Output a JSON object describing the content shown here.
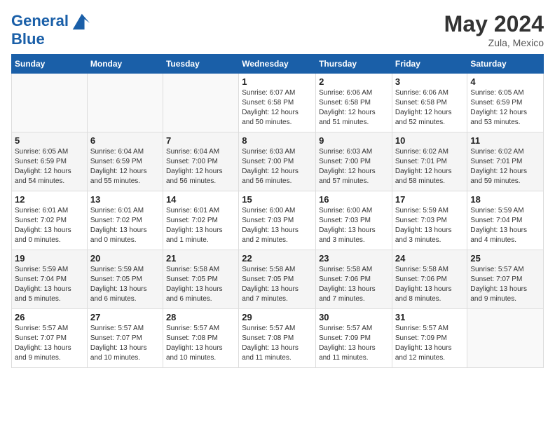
{
  "header": {
    "logo_line1": "General",
    "logo_line2": "Blue",
    "month": "May 2024",
    "location": "Zula, Mexico"
  },
  "weekdays": [
    "Sunday",
    "Monday",
    "Tuesday",
    "Wednesday",
    "Thursday",
    "Friday",
    "Saturday"
  ],
  "weeks": [
    [
      {
        "day": "",
        "info": ""
      },
      {
        "day": "",
        "info": ""
      },
      {
        "day": "",
        "info": ""
      },
      {
        "day": "1",
        "info": "Sunrise: 6:07 AM\nSunset: 6:58 PM\nDaylight: 12 hours\nand 50 minutes."
      },
      {
        "day": "2",
        "info": "Sunrise: 6:06 AM\nSunset: 6:58 PM\nDaylight: 12 hours\nand 51 minutes."
      },
      {
        "day": "3",
        "info": "Sunrise: 6:06 AM\nSunset: 6:58 PM\nDaylight: 12 hours\nand 52 minutes."
      },
      {
        "day": "4",
        "info": "Sunrise: 6:05 AM\nSunset: 6:59 PM\nDaylight: 12 hours\nand 53 minutes."
      }
    ],
    [
      {
        "day": "5",
        "info": "Sunrise: 6:05 AM\nSunset: 6:59 PM\nDaylight: 12 hours\nand 54 minutes."
      },
      {
        "day": "6",
        "info": "Sunrise: 6:04 AM\nSunset: 6:59 PM\nDaylight: 12 hours\nand 55 minutes."
      },
      {
        "day": "7",
        "info": "Sunrise: 6:04 AM\nSunset: 7:00 PM\nDaylight: 12 hours\nand 56 minutes."
      },
      {
        "day": "8",
        "info": "Sunrise: 6:03 AM\nSunset: 7:00 PM\nDaylight: 12 hours\nand 56 minutes."
      },
      {
        "day": "9",
        "info": "Sunrise: 6:03 AM\nSunset: 7:00 PM\nDaylight: 12 hours\nand 57 minutes."
      },
      {
        "day": "10",
        "info": "Sunrise: 6:02 AM\nSunset: 7:01 PM\nDaylight: 12 hours\nand 58 minutes."
      },
      {
        "day": "11",
        "info": "Sunrise: 6:02 AM\nSunset: 7:01 PM\nDaylight: 12 hours\nand 59 minutes."
      }
    ],
    [
      {
        "day": "12",
        "info": "Sunrise: 6:01 AM\nSunset: 7:02 PM\nDaylight: 13 hours\nand 0 minutes."
      },
      {
        "day": "13",
        "info": "Sunrise: 6:01 AM\nSunset: 7:02 PM\nDaylight: 13 hours\nand 0 minutes."
      },
      {
        "day": "14",
        "info": "Sunrise: 6:01 AM\nSunset: 7:02 PM\nDaylight: 13 hours\nand 1 minute."
      },
      {
        "day": "15",
        "info": "Sunrise: 6:00 AM\nSunset: 7:03 PM\nDaylight: 13 hours\nand 2 minutes."
      },
      {
        "day": "16",
        "info": "Sunrise: 6:00 AM\nSunset: 7:03 PM\nDaylight: 13 hours\nand 3 minutes."
      },
      {
        "day": "17",
        "info": "Sunrise: 5:59 AM\nSunset: 7:03 PM\nDaylight: 13 hours\nand 3 minutes."
      },
      {
        "day": "18",
        "info": "Sunrise: 5:59 AM\nSunset: 7:04 PM\nDaylight: 13 hours\nand 4 minutes."
      }
    ],
    [
      {
        "day": "19",
        "info": "Sunrise: 5:59 AM\nSunset: 7:04 PM\nDaylight: 13 hours\nand 5 minutes."
      },
      {
        "day": "20",
        "info": "Sunrise: 5:59 AM\nSunset: 7:05 PM\nDaylight: 13 hours\nand 6 minutes."
      },
      {
        "day": "21",
        "info": "Sunrise: 5:58 AM\nSunset: 7:05 PM\nDaylight: 13 hours\nand 6 minutes."
      },
      {
        "day": "22",
        "info": "Sunrise: 5:58 AM\nSunset: 7:05 PM\nDaylight: 13 hours\nand 7 minutes."
      },
      {
        "day": "23",
        "info": "Sunrise: 5:58 AM\nSunset: 7:06 PM\nDaylight: 13 hours\nand 7 minutes."
      },
      {
        "day": "24",
        "info": "Sunrise: 5:58 AM\nSunset: 7:06 PM\nDaylight: 13 hours\nand 8 minutes."
      },
      {
        "day": "25",
        "info": "Sunrise: 5:57 AM\nSunset: 7:07 PM\nDaylight: 13 hours\nand 9 minutes."
      }
    ],
    [
      {
        "day": "26",
        "info": "Sunrise: 5:57 AM\nSunset: 7:07 PM\nDaylight: 13 hours\nand 9 minutes."
      },
      {
        "day": "27",
        "info": "Sunrise: 5:57 AM\nSunset: 7:07 PM\nDaylight: 13 hours\nand 10 minutes."
      },
      {
        "day": "28",
        "info": "Sunrise: 5:57 AM\nSunset: 7:08 PM\nDaylight: 13 hours\nand 10 minutes."
      },
      {
        "day": "29",
        "info": "Sunrise: 5:57 AM\nSunset: 7:08 PM\nDaylight: 13 hours\nand 11 minutes."
      },
      {
        "day": "30",
        "info": "Sunrise: 5:57 AM\nSunset: 7:09 PM\nDaylight: 13 hours\nand 11 minutes."
      },
      {
        "day": "31",
        "info": "Sunrise: 5:57 AM\nSunset: 7:09 PM\nDaylight: 13 hours\nand 12 minutes."
      },
      {
        "day": "",
        "info": ""
      }
    ]
  ]
}
